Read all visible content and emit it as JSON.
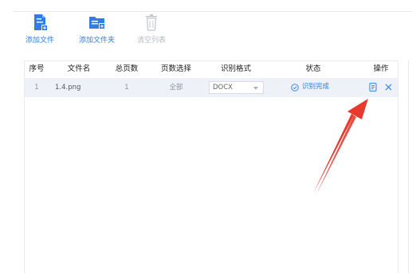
{
  "toolbar": {
    "add_file_label": "添加文件",
    "add_folder_label": "添加文件夹",
    "clear_label": "清空列表"
  },
  "table": {
    "columns": [
      "序号",
      "文件名",
      "总页数",
      "页数选择",
      "识别格式",
      "状态",
      "操作"
    ],
    "rows": [
      {
        "index": "1",
        "filename": "1.4.png",
        "total_pages": "1",
        "page_selection": "全部",
        "format": "DOCX",
        "status": "识别完成"
      }
    ]
  },
  "colors": {
    "accent": "#2f7ee7",
    "arrow": "#e8392f",
    "row_bg": "#eef2f8"
  },
  "icons": {
    "add_file": "add-file-icon",
    "add_folder": "add-folder-icon",
    "clear": "trash-icon",
    "status": "check-circle-icon",
    "open": "document-icon",
    "remove": "close-icon"
  }
}
